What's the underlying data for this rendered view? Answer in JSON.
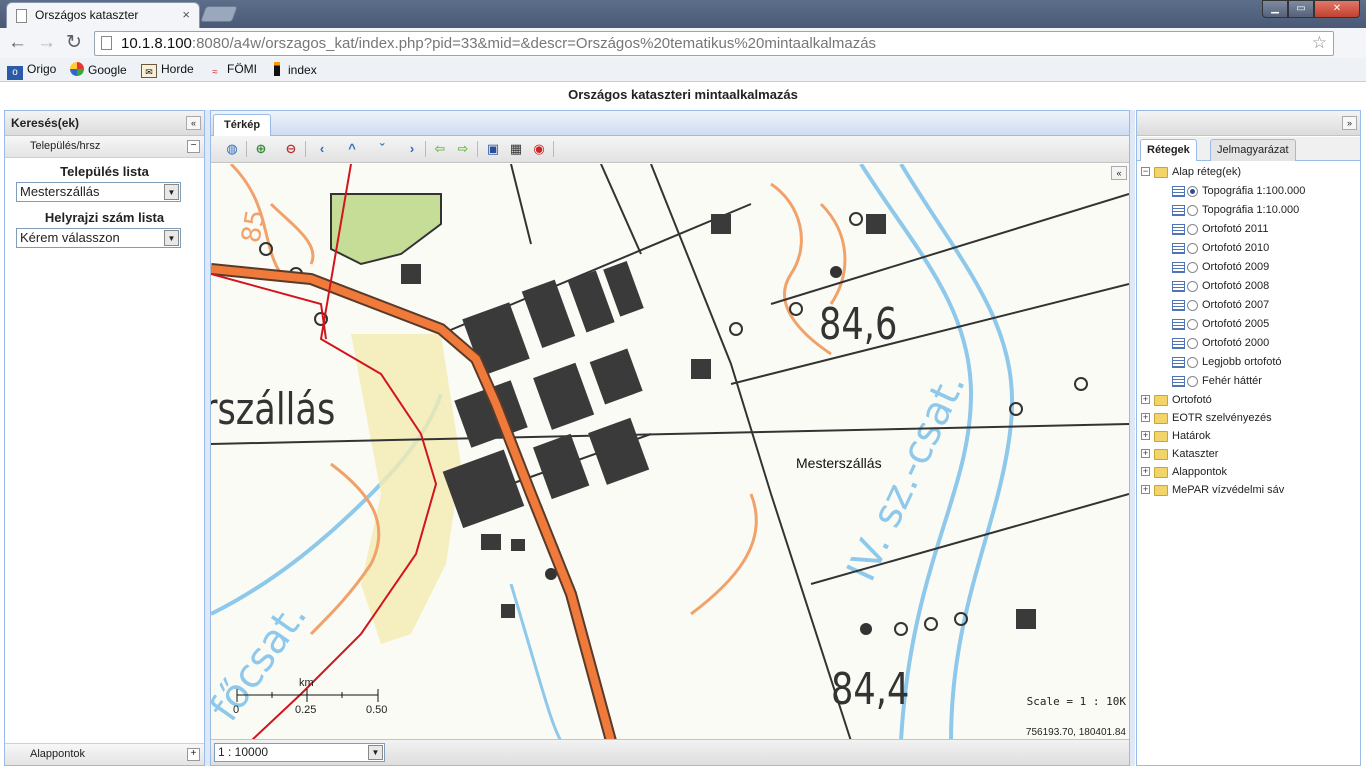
{
  "browser": {
    "tab_title": "Országos kataszter",
    "tab_close": "×",
    "url_host": "10.1.8.100",
    "url_rest": ":8080/a4w/orszagos_kat/index.php?pid=33&mid=&descr=Országos%20tematikus%20mintaalkalmazás",
    "bookmarks": [
      "Origo",
      "Google",
      "Horde",
      "FÖMI",
      "index"
    ]
  },
  "app": {
    "title": "Országos kataszteri mintaalkalmazás"
  },
  "left_panel": {
    "header": "Keresés(ek)",
    "section": "Település/hrsz",
    "settlement_label": "Település lista",
    "settlement_value": "Mesterszállás",
    "parcel_label": "Helyrajzi szám lista",
    "parcel_value": "Kérem válasszon",
    "bottom_section": "Alappontok"
  },
  "center_panel": {
    "tab": "Térkép",
    "map_place_label": "Mesterszállás",
    "scale_text": "Scale = 1 : 10K",
    "coords": "756193.70, 180401.84",
    "scalebar_unit": "km",
    "scalebar_ticks": [
      "0",
      "0.25",
      "0.50"
    ],
    "scale_select": "1 : 10000"
  },
  "right_panel": {
    "tabs": [
      "Rétegek",
      "Jelmagyarázat"
    ],
    "tree": {
      "base_group": "Alap réteg(ek)",
      "base_layers": [
        {
          "label": "Topográfia 1:100.000",
          "selected": true
        },
        {
          "label": "Topográfia 1:10.000",
          "selected": false
        },
        {
          "label": "Ortofotó 2011",
          "selected": false
        },
        {
          "label": "Ortofotó 2010",
          "selected": false
        },
        {
          "label": "Ortofotó 2009",
          "selected": false
        },
        {
          "label": "Ortofotó 2008",
          "selected": false
        },
        {
          "label": "Ortofotó 2007",
          "selected": false
        },
        {
          "label": "Ortofotó 2005",
          "selected": false
        },
        {
          "label": "Ortofotó 2000",
          "selected": false
        },
        {
          "label": "Legjobb ortofotó",
          "selected": false
        },
        {
          "label": "Fehér háttér",
          "selected": false
        }
      ],
      "groups": [
        "Ortofotó",
        "EOTR szelvényezés",
        "Határok",
        "Kataszter",
        "Alappontok",
        "MePAR vízvédelmi sáv"
      ]
    }
  },
  "colors": {
    "panel_border": "#99bbe8",
    "road_orange": "#f07a3a",
    "boundary_red": "#d2141c",
    "contour_orange": "#f0a26a",
    "water_blue": "#8ec8ea",
    "building_dark": "#3a3a3a"
  }
}
